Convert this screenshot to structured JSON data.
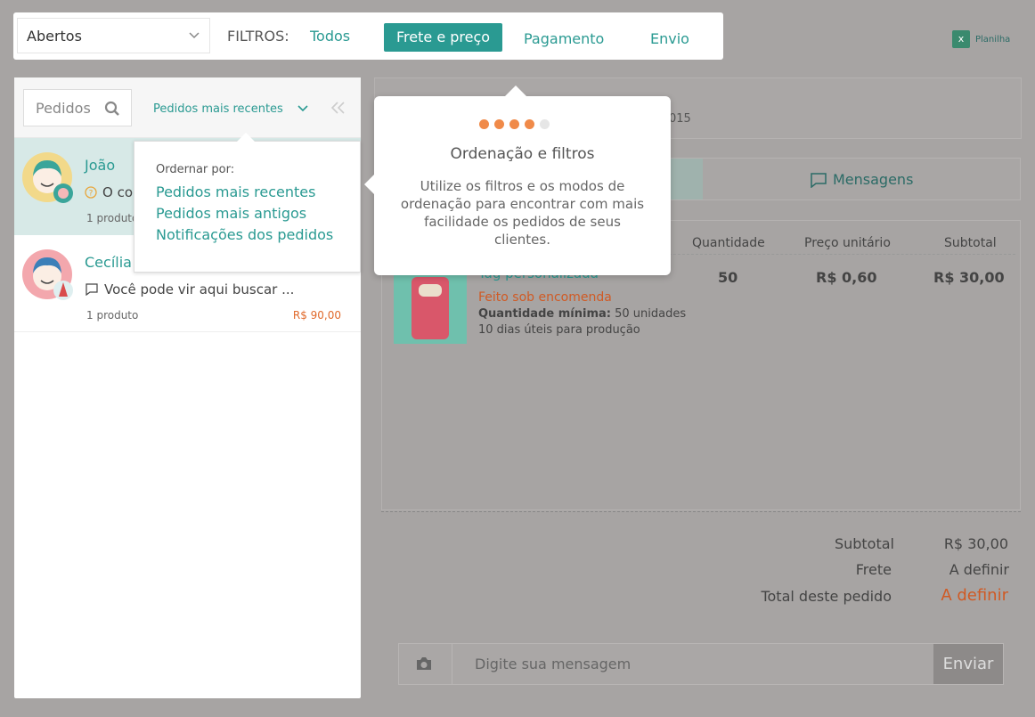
{
  "topbar": {
    "status_value": "Abertos",
    "filters_label": "FILTROS:",
    "filters": [
      "Todos",
      "Frete e preço",
      "Pagamento",
      "Envio"
    ],
    "active_filter": "Frete e preço"
  },
  "spreadsheet": {
    "label": "Planilha",
    "icon": "excel-icon"
  },
  "left": {
    "search_placeholder": "Pedidos",
    "sort_value": "Pedidos mais recentes",
    "orders": [
      {
        "name": "João",
        "message": "O co",
        "count": "1 produto",
        "price": ""
      },
      {
        "name": "Cecília",
        "message": "Você pode vir aqui buscar ...",
        "count": "1 produto",
        "price": "R$ 90,00"
      }
    ]
  },
  "sort_popover": {
    "title": "Ordernar por:",
    "options": [
      "Pedidos mais recentes",
      "Pedidos mais antigos",
      "Notificações dos pedidos"
    ]
  },
  "tour": {
    "title": "Ordenação e filtros",
    "body": "Utilize os filtros e os modos de ordenação para encontrar com mais facilidade os pedidos de seus clientes.",
    "step": 4,
    "steps_total": 5
  },
  "detail": {
    "date_fragment": "015",
    "tab_messages": "Mensagens",
    "headers": {
      "quantity": "Quantidade",
      "unit_price": "Preço unitário",
      "subtotal": "Subtotal"
    },
    "product": {
      "name": "Tag personalizada",
      "custom": "Feito sob encomenda",
      "min_label": "Quantidade mínima:",
      "min_value": " 50 unidades",
      "days": "10 dias úteis para produção",
      "quantity": "50",
      "unit_price": "R$ 0,60",
      "subtotal": "R$ 30,00"
    },
    "totals": {
      "subtotal_label": "Subtotal",
      "subtotal_value": "R$ 30,00",
      "shipping_label": "Frete",
      "shipping_value": "A definir",
      "total_label": "Total deste pedido",
      "total_value": "A definir"
    },
    "composer": {
      "placeholder": "Digite sua mensagem",
      "send": "Enviar"
    }
  },
  "colors": {
    "accent": "#2a9a92",
    "orange": "#e06a2c",
    "overlay": "#a7a4a3"
  }
}
